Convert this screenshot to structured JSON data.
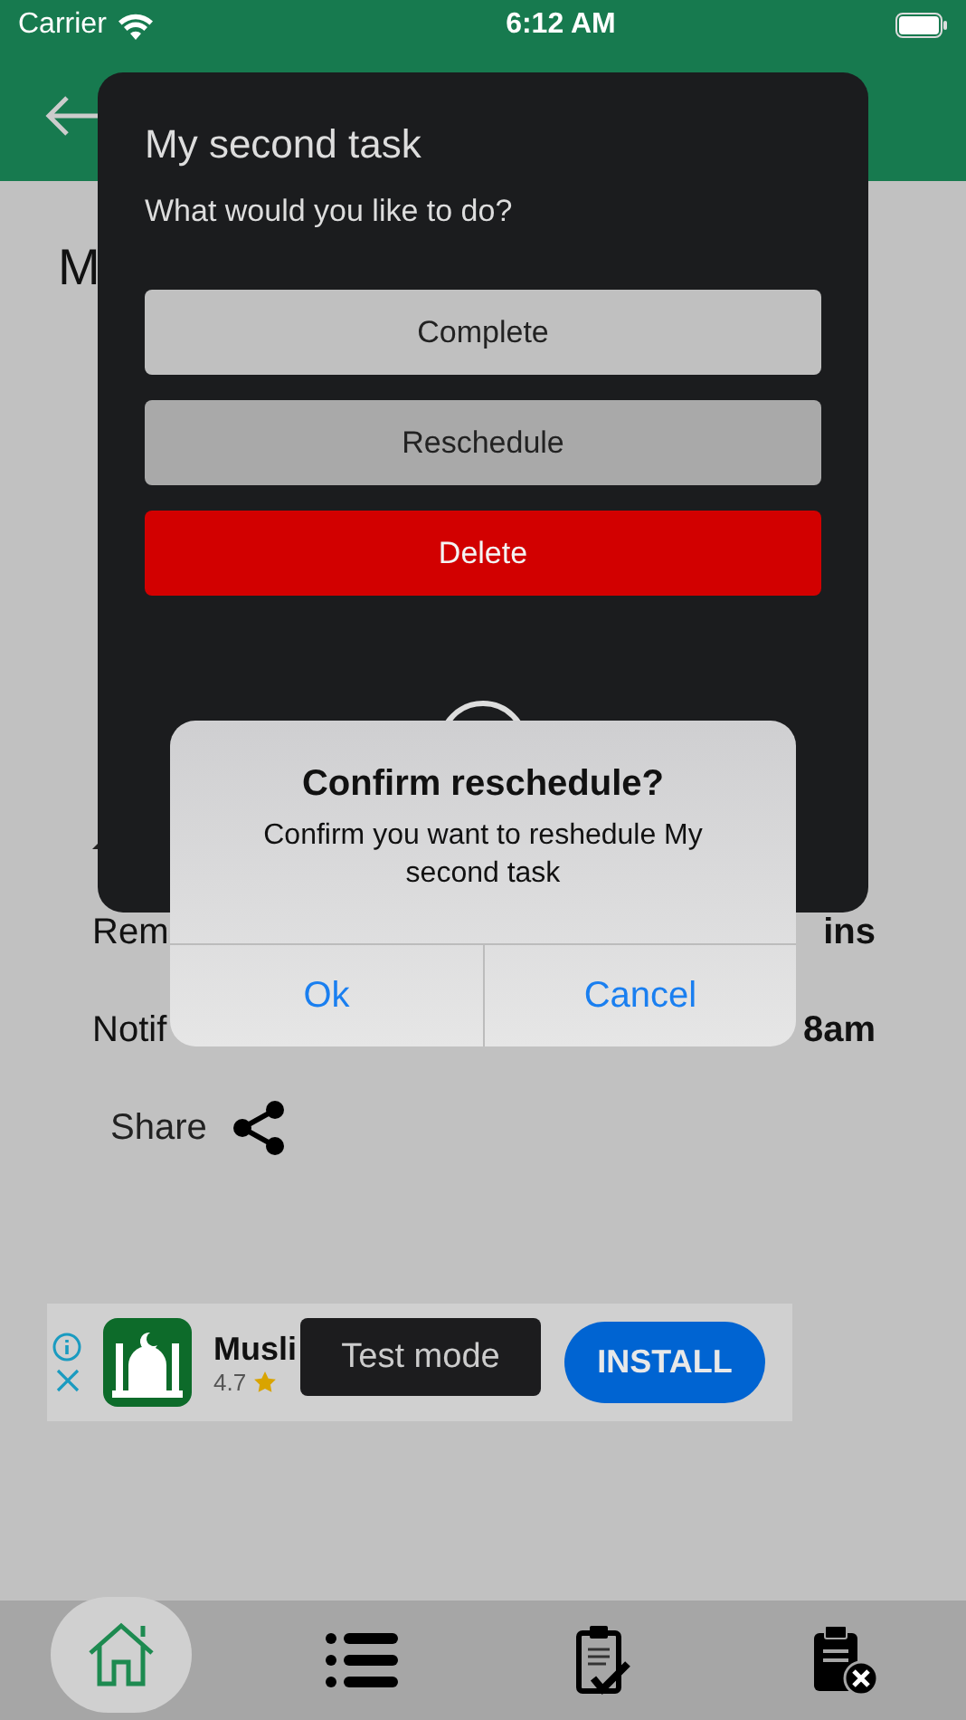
{
  "status_bar": {
    "carrier": "Carrier",
    "time": "6:12 AM"
  },
  "page": {
    "title": "M",
    "rows": [
      {
        "kind": "bell"
      },
      {
        "kind": "text",
        "label": "Rem",
        "value": "ins"
      },
      {
        "kind": "text",
        "label": "Notif",
        "value": "8am"
      }
    ],
    "share": "Share"
  },
  "dialog": {
    "title": "My second task",
    "prompt": "What would you like to do?",
    "actions": [
      {
        "label": "Complete",
        "kind": "default"
      },
      {
        "label": "Reschedule",
        "kind": "pressed"
      },
      {
        "label": "Delete",
        "kind": "danger"
      }
    ]
  },
  "alert": {
    "title": "Confirm reschedule?",
    "message": "Confirm you want to reshedule My second task",
    "buttons": [
      "Ok",
      "Cancel"
    ]
  },
  "ad": {
    "app_name": "Musli",
    "rating": "4.7",
    "cta": "INSTALL"
  },
  "toast": "Test mode",
  "tabs": [
    {
      "kind": "home",
      "selected": true
    },
    {
      "kind": "list",
      "selected": false
    },
    {
      "kind": "done",
      "selected": false
    },
    {
      "kind": "deleted",
      "selected": false
    }
  ]
}
